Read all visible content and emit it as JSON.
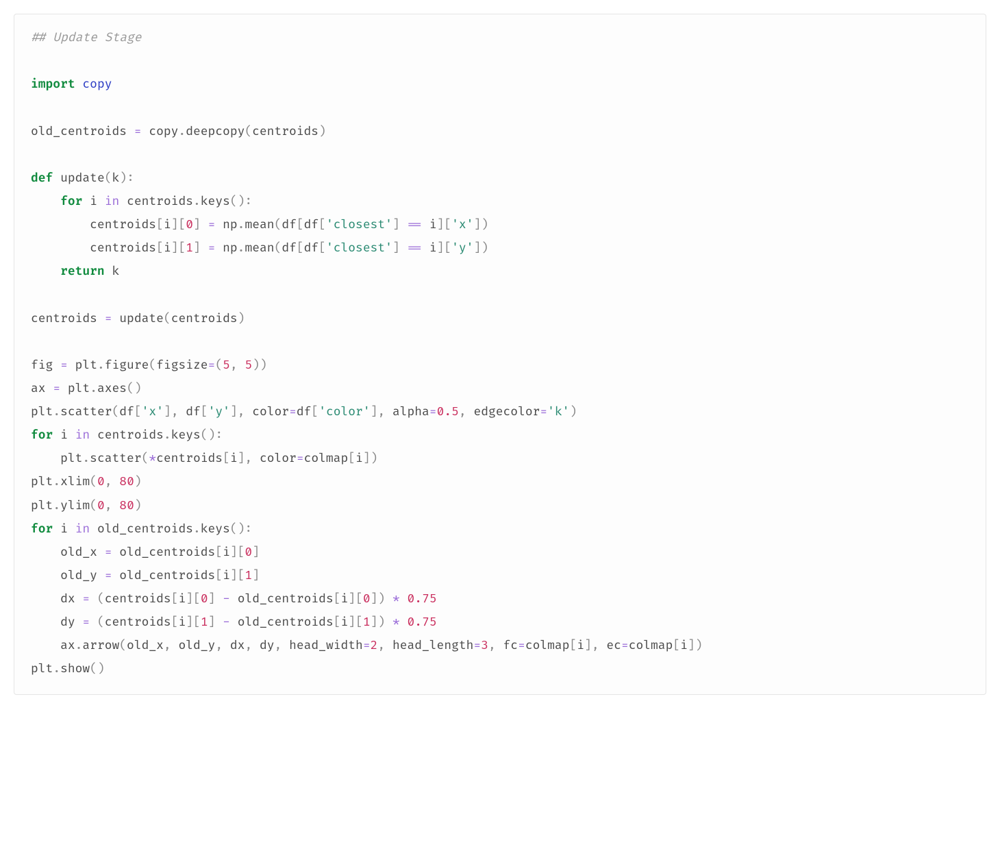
{
  "t": {
    "comment": "## Update Stage",
    "import": "import",
    "copy": "copy",
    "old_centroids": "old_centroids",
    "eq": "=",
    "dot": ".",
    "deepcopy": "deepcopy",
    "lp": "(",
    "rp": ")",
    "centroids": "centroids",
    "def": "def",
    "update": "update",
    "k": "k",
    "colon": ":",
    "for": "for",
    "i": "i",
    "in": "in",
    "keys": "keys",
    "lb": "[",
    "rb": "]",
    "n0": "0",
    "n1": "1",
    "np": "np",
    "mean": "mean",
    "df": "df",
    "s_closest": "'closest'",
    "eqeq": "==",
    "s_x": "'x'",
    "s_y": "'y'",
    "return": "return",
    "fig": "fig",
    "plt": "plt",
    "figure": "figure",
    "figsize": "figsize",
    "n5": "5",
    "comma": ",",
    "sp": " ",
    "ax": "ax",
    "axes": "axes",
    "scatter": "scatter",
    "color": "color",
    "s_color": "'color'",
    "alpha": "alpha",
    "n05": "0.5",
    "edgecolor": "edgecolor",
    "s_k": "'k'",
    "star": "*",
    "colmap": "colmap",
    "xlim": "xlim",
    "ylim": "ylim",
    "n80": "80",
    "old_x": "old_x",
    "old_y": "old_y",
    "dx": "dx",
    "dy": "dy",
    "minus": "-",
    "n075": "0.75",
    "arrow": "arrow",
    "head_width": "head_width",
    "n2": "2",
    "head_length": "head_length",
    "n3": "3",
    "fc": "fc",
    "ec": "ec",
    "show": "show"
  }
}
